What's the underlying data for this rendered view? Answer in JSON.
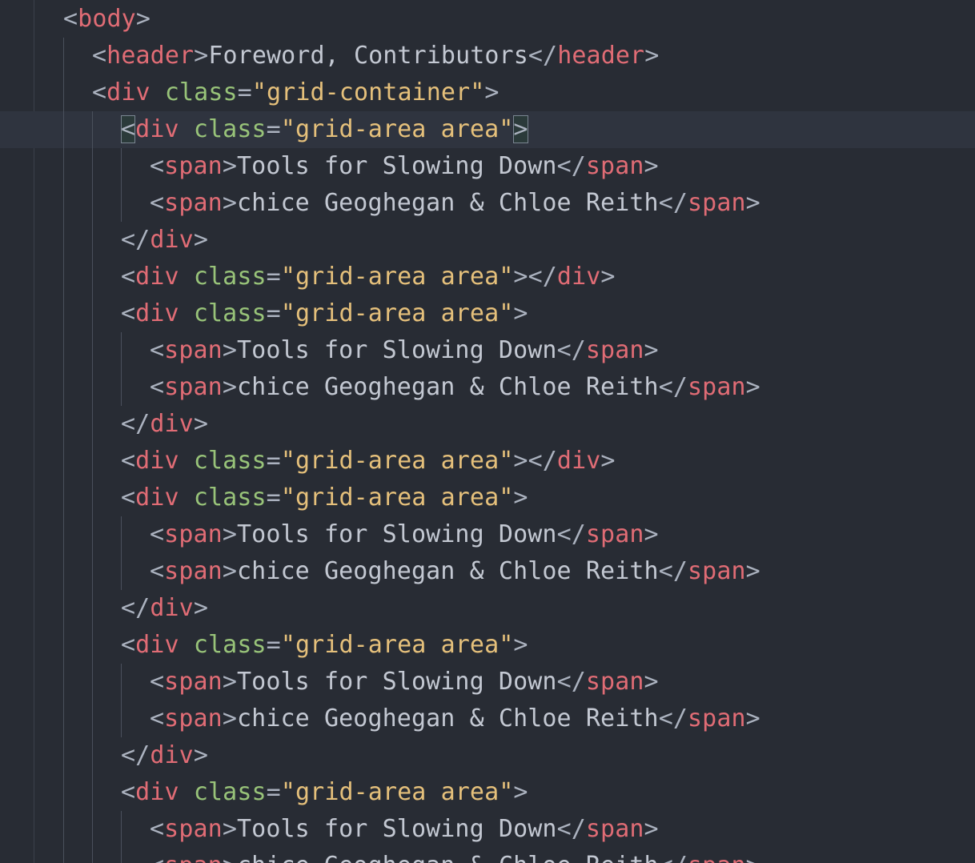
{
  "editor": {
    "language": "html",
    "theme_colors": {
      "background": "#282c34",
      "current_line": "#2f343f",
      "tag": "#e06c75",
      "attribute": "#98c379",
      "string": "#e5c07b",
      "punctuation": "#abb2bf",
      "text": "#c3c8d2"
    },
    "lines": [
      {
        "indent": 0,
        "tokens": [
          [
            "punct",
            "<"
          ],
          [
            "tag",
            "body"
          ],
          [
            "punct",
            ">"
          ]
        ]
      },
      {
        "indent": 1,
        "tokens": [
          [
            "punct",
            "<"
          ],
          [
            "tag",
            "header"
          ],
          [
            "punct",
            ">"
          ],
          [
            "text",
            "Foreword, Contributors"
          ],
          [
            "punct",
            "</"
          ],
          [
            "tag",
            "header"
          ],
          [
            "punct",
            ">"
          ]
        ]
      },
      {
        "indent": 1,
        "tokens": [
          [
            "punct",
            "<"
          ],
          [
            "tag",
            "div"
          ],
          [
            "text",
            " "
          ],
          [
            "attr",
            "class"
          ],
          [
            "punct",
            "="
          ],
          [
            "str",
            "\"grid-container\""
          ],
          [
            "punct",
            ">"
          ]
        ]
      },
      {
        "indent": 2,
        "current": true,
        "tokens": [
          [
            "punct",
            "<"
          ],
          [
            "tag",
            "div"
          ],
          [
            "text",
            " "
          ],
          [
            "attr",
            "class"
          ],
          [
            "punct",
            "="
          ],
          [
            "str",
            "\"grid-area area\""
          ],
          [
            "punct",
            ">"
          ]
        ]
      },
      {
        "indent": 3,
        "tokens": [
          [
            "punct",
            "<"
          ],
          [
            "tag",
            "span"
          ],
          [
            "punct",
            ">"
          ],
          [
            "text",
            "Tools for Slowing Down"
          ],
          [
            "punct",
            "</"
          ],
          [
            "tag",
            "span"
          ],
          [
            "punct",
            ">"
          ]
        ]
      },
      {
        "indent": 3,
        "tokens": [
          [
            "punct",
            "<"
          ],
          [
            "tag",
            "span"
          ],
          [
            "punct",
            ">"
          ],
          [
            "text",
            "chice Geoghegan & Chloe Reith"
          ],
          [
            "punct",
            "</"
          ],
          [
            "tag",
            "span"
          ],
          [
            "punct",
            ">"
          ]
        ]
      },
      {
        "indent": 2,
        "tokens": [
          [
            "punct",
            "</"
          ],
          [
            "tag",
            "div"
          ],
          [
            "punct",
            ">"
          ]
        ]
      },
      {
        "indent": 2,
        "tokens": [
          [
            "punct",
            "<"
          ],
          [
            "tag",
            "div"
          ],
          [
            "text",
            " "
          ],
          [
            "attr",
            "class"
          ],
          [
            "punct",
            "="
          ],
          [
            "str",
            "\"grid-area area\""
          ],
          [
            "punct",
            "></"
          ],
          [
            "tag",
            "div"
          ],
          [
            "punct",
            ">"
          ]
        ]
      },
      {
        "indent": 2,
        "tokens": [
          [
            "punct",
            "<"
          ],
          [
            "tag",
            "div"
          ],
          [
            "text",
            " "
          ],
          [
            "attr",
            "class"
          ],
          [
            "punct",
            "="
          ],
          [
            "str",
            "\"grid-area area\""
          ],
          [
            "punct",
            ">"
          ]
        ]
      },
      {
        "indent": 3,
        "tokens": [
          [
            "punct",
            "<"
          ],
          [
            "tag",
            "span"
          ],
          [
            "punct",
            ">"
          ],
          [
            "text",
            "Tools for Slowing Down"
          ],
          [
            "punct",
            "</"
          ],
          [
            "tag",
            "span"
          ],
          [
            "punct",
            ">"
          ]
        ]
      },
      {
        "indent": 3,
        "tokens": [
          [
            "punct",
            "<"
          ],
          [
            "tag",
            "span"
          ],
          [
            "punct",
            ">"
          ],
          [
            "text",
            "chice Geoghegan & Chloe Reith"
          ],
          [
            "punct",
            "</"
          ],
          [
            "tag",
            "span"
          ],
          [
            "punct",
            ">"
          ]
        ]
      },
      {
        "indent": 2,
        "tokens": [
          [
            "punct",
            "</"
          ],
          [
            "tag",
            "div"
          ],
          [
            "punct",
            ">"
          ]
        ]
      },
      {
        "indent": 2,
        "tokens": [
          [
            "punct",
            "<"
          ],
          [
            "tag",
            "div"
          ],
          [
            "text",
            " "
          ],
          [
            "attr",
            "class"
          ],
          [
            "punct",
            "="
          ],
          [
            "str",
            "\"grid-area area\""
          ],
          [
            "punct",
            "></"
          ],
          [
            "tag",
            "div"
          ],
          [
            "punct",
            ">"
          ]
        ]
      },
      {
        "indent": 2,
        "tokens": [
          [
            "punct",
            "<"
          ],
          [
            "tag",
            "div"
          ],
          [
            "text",
            " "
          ],
          [
            "attr",
            "class"
          ],
          [
            "punct",
            "="
          ],
          [
            "str",
            "\"grid-area area\""
          ],
          [
            "punct",
            ">"
          ]
        ]
      },
      {
        "indent": 3,
        "tokens": [
          [
            "punct",
            "<"
          ],
          [
            "tag",
            "span"
          ],
          [
            "punct",
            ">"
          ],
          [
            "text",
            "Tools for Slowing Down"
          ],
          [
            "punct",
            "</"
          ],
          [
            "tag",
            "span"
          ],
          [
            "punct",
            ">"
          ]
        ]
      },
      {
        "indent": 3,
        "tokens": [
          [
            "punct",
            "<"
          ],
          [
            "tag",
            "span"
          ],
          [
            "punct",
            ">"
          ],
          [
            "text",
            "chice Geoghegan & Chloe Reith"
          ],
          [
            "punct",
            "</"
          ],
          [
            "tag",
            "span"
          ],
          [
            "punct",
            ">"
          ]
        ]
      },
      {
        "indent": 2,
        "tokens": [
          [
            "punct",
            "</"
          ],
          [
            "tag",
            "div"
          ],
          [
            "punct",
            ">"
          ]
        ]
      },
      {
        "indent": 2,
        "tokens": [
          [
            "punct",
            "<"
          ],
          [
            "tag",
            "div"
          ],
          [
            "text",
            " "
          ],
          [
            "attr",
            "class"
          ],
          [
            "punct",
            "="
          ],
          [
            "str",
            "\"grid-area area\""
          ],
          [
            "punct",
            ">"
          ]
        ]
      },
      {
        "indent": 3,
        "tokens": [
          [
            "punct",
            "<"
          ],
          [
            "tag",
            "span"
          ],
          [
            "punct",
            ">"
          ],
          [
            "text",
            "Tools for Slowing Down"
          ],
          [
            "punct",
            "</"
          ],
          [
            "tag",
            "span"
          ],
          [
            "punct",
            ">"
          ]
        ]
      },
      {
        "indent": 3,
        "tokens": [
          [
            "punct",
            "<"
          ],
          [
            "tag",
            "span"
          ],
          [
            "punct",
            ">"
          ],
          [
            "text",
            "chice Geoghegan & Chloe Reith"
          ],
          [
            "punct",
            "</"
          ],
          [
            "tag",
            "span"
          ],
          [
            "punct",
            ">"
          ]
        ]
      },
      {
        "indent": 2,
        "tokens": [
          [
            "punct",
            "</"
          ],
          [
            "tag",
            "div"
          ],
          [
            "punct",
            ">"
          ]
        ]
      },
      {
        "indent": 2,
        "tokens": [
          [
            "punct",
            "<"
          ],
          [
            "tag",
            "div"
          ],
          [
            "text",
            " "
          ],
          [
            "attr",
            "class"
          ],
          [
            "punct",
            "="
          ],
          [
            "str",
            "\"grid-area area\""
          ],
          [
            "punct",
            ">"
          ]
        ]
      },
      {
        "indent": 3,
        "tokens": [
          [
            "punct",
            "<"
          ],
          [
            "tag",
            "span"
          ],
          [
            "punct",
            ">"
          ],
          [
            "text",
            "Tools for Slowing Down"
          ],
          [
            "punct",
            "</"
          ],
          [
            "tag",
            "span"
          ],
          [
            "punct",
            ">"
          ]
        ]
      },
      {
        "indent": 3,
        "tokens": [
          [
            "punct",
            "<"
          ],
          [
            "tag",
            "span"
          ],
          [
            "punct",
            ">"
          ],
          [
            "text",
            "chice Geoghegan & Chloe Reith"
          ],
          [
            "punct",
            "</"
          ],
          [
            "tag",
            "span"
          ],
          [
            "punct",
            ">"
          ]
        ]
      }
    ]
  }
}
